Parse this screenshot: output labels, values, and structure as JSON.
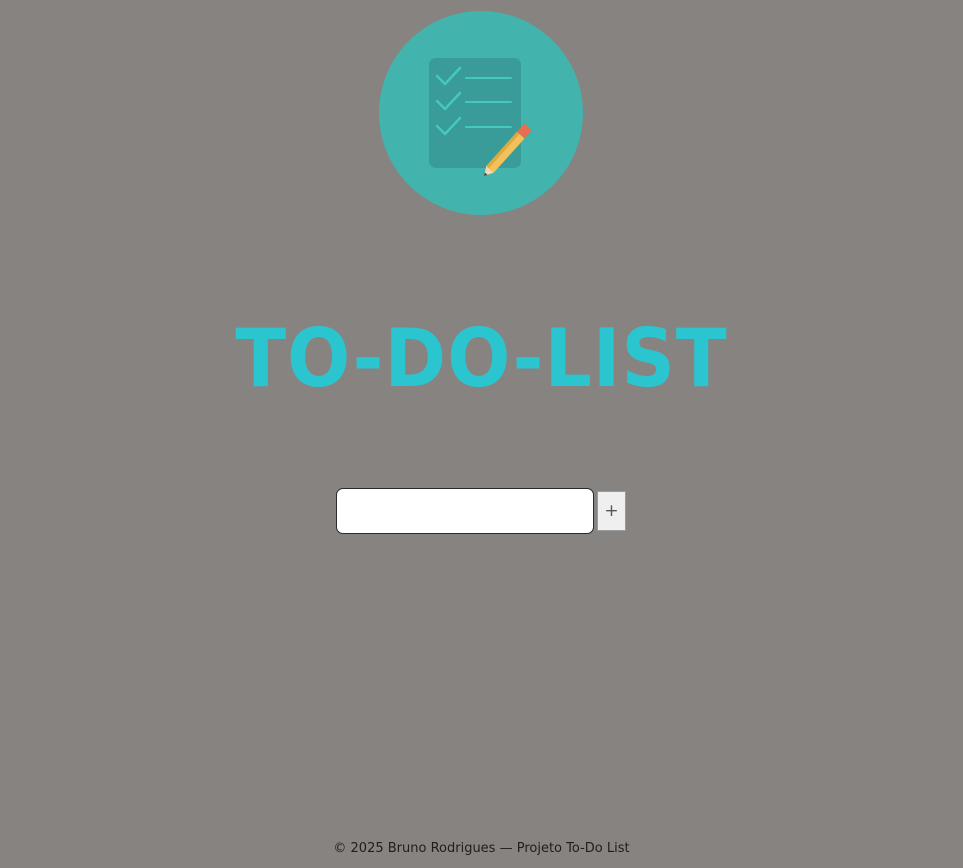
{
  "logo": {
    "icon": "checklist-clipboard-pencil-icon",
    "circle_color": "#43b3ad",
    "clipboard_color": "#3a9c98",
    "check_color": "#45c8c0"
  },
  "header": {
    "title": "TO-DO-LIST",
    "title_color": "#2bc5cf"
  },
  "task_form": {
    "input_value": "",
    "input_placeholder": "",
    "add_label": "+"
  },
  "footer": {
    "text": "© 2025 Bruno Rodrigues — Projeto To-Do List"
  },
  "colors": {
    "background": "#878381"
  }
}
